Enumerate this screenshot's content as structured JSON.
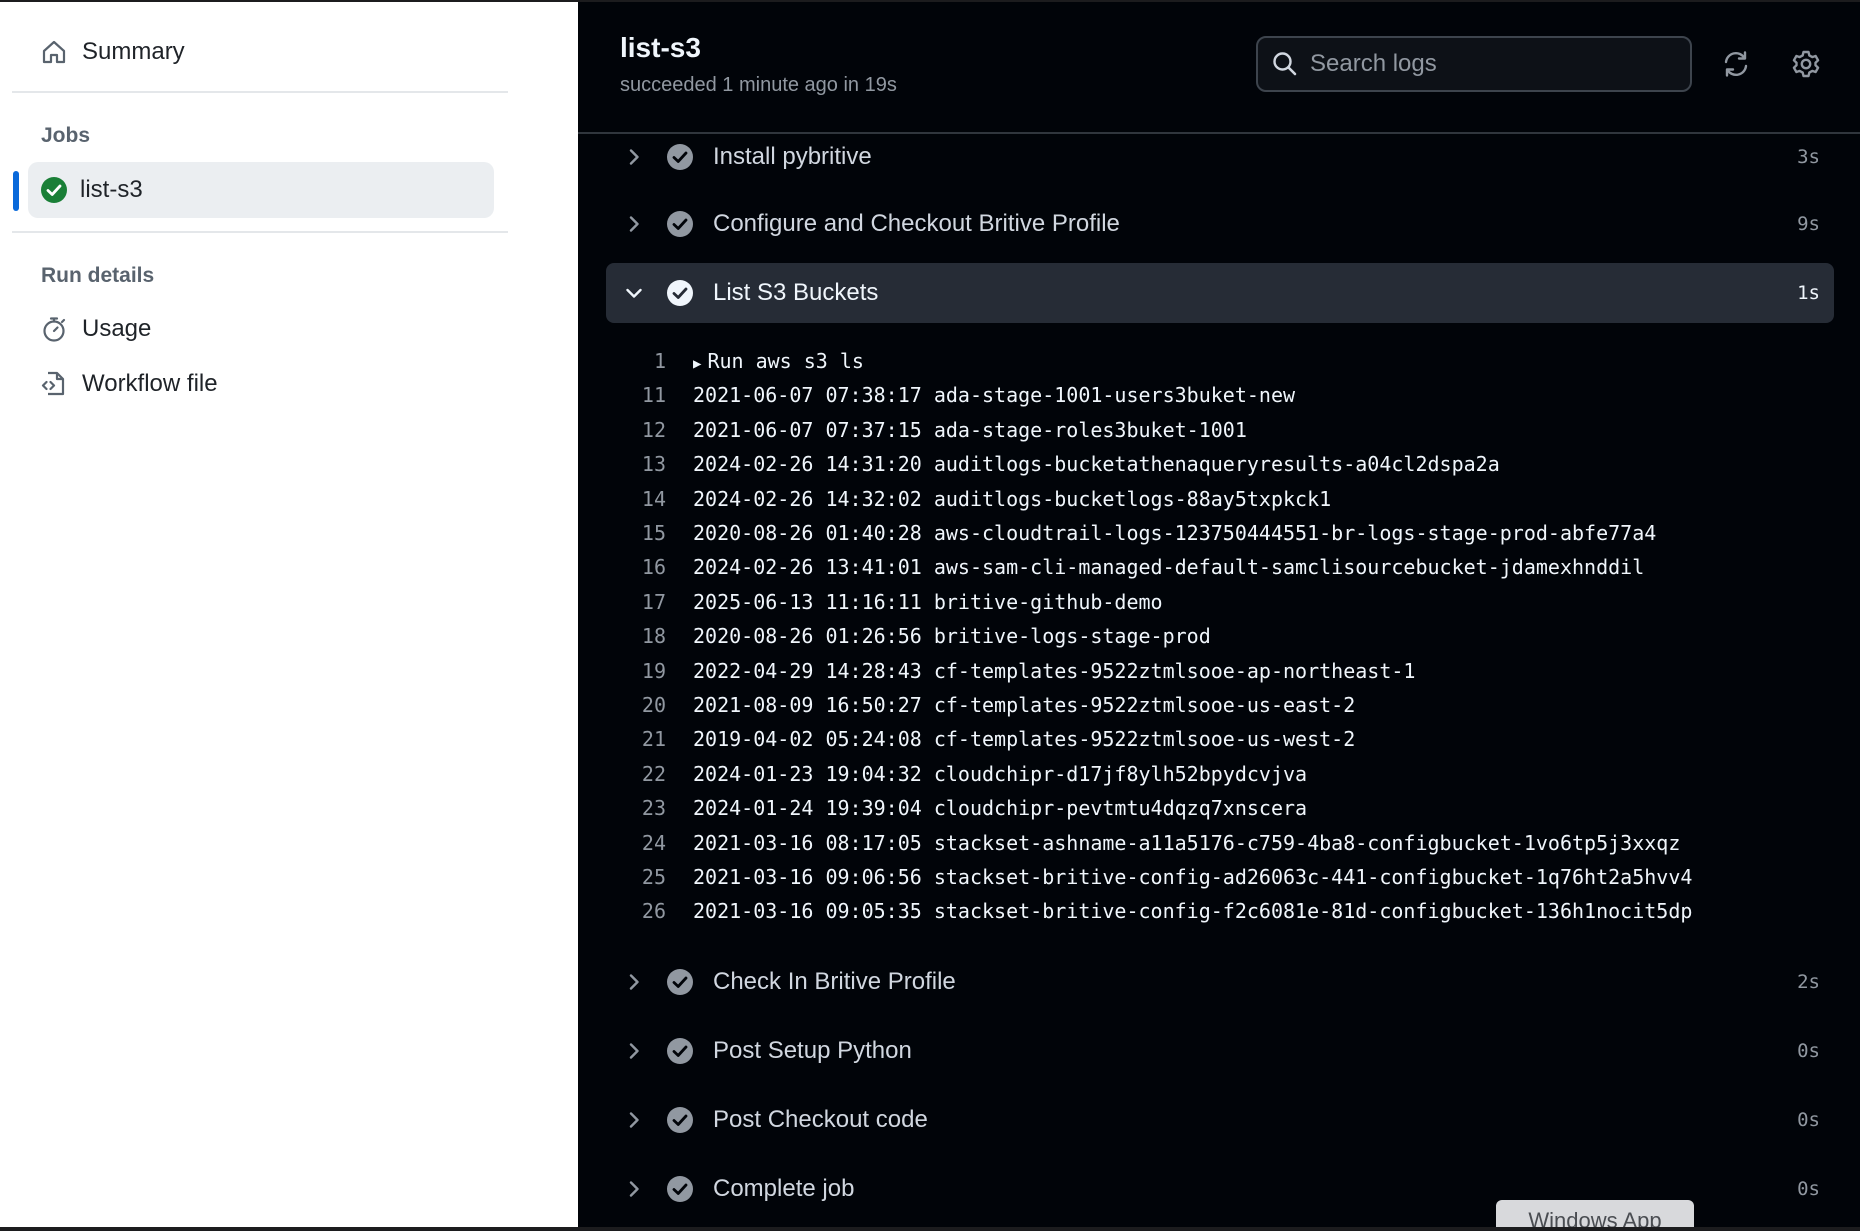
{
  "sidebar": {
    "summary_label": "Summary",
    "jobs_heading": "Jobs",
    "active_job": "list-s3",
    "run_details_heading": "Run details",
    "usage_label": "Usage",
    "workflow_file_label": "Workflow file",
    "accent_color": "#0969da",
    "success_color": "#1a7f37"
  },
  "header": {
    "title": "list-s3",
    "status": "succeeded 1 minute ago in 19s",
    "search_placeholder": "Search logs"
  },
  "steps_before": [
    {
      "name": "Install pybritive",
      "duration": "3s"
    },
    {
      "name": "Configure and Checkout Britive Profile",
      "duration": "9s"
    }
  ],
  "expanded_step": {
    "name": "List S3 Buckets",
    "duration": "1s"
  },
  "log": {
    "run_line": {
      "num": "1",
      "text": "Run aws s3 ls"
    },
    "lines": [
      {
        "num": "11",
        "text": "2021-06-07 07:38:17 ada-stage-1001-users3buket-new"
      },
      {
        "num": "12",
        "text": "2021-06-07 07:37:15 ada-stage-roles3buket-1001"
      },
      {
        "num": "13",
        "text": "2024-02-26 14:31:20 auditlogs-bucketathenaqueryresults-a04cl2dspa2a"
      },
      {
        "num": "14",
        "text": "2024-02-26 14:32:02 auditlogs-bucketlogs-88ay5txpkck1"
      },
      {
        "num": "15",
        "text": "2020-08-26 01:40:28 aws-cloudtrail-logs-123750444551-br-logs-stage-prod-abfe77a4"
      },
      {
        "num": "16",
        "text": "2024-02-26 13:41:01 aws-sam-cli-managed-default-samclisourcebucket-jdamexhnddil"
      },
      {
        "num": "17",
        "text": "2025-06-13 11:16:11 britive-github-demo"
      },
      {
        "num": "18",
        "text": "2020-08-26 01:26:56 britive-logs-stage-prod"
      },
      {
        "num": "19",
        "text": "2022-04-29 14:28:43 cf-templates-9522ztmlsooe-ap-northeast-1"
      },
      {
        "num": "20",
        "text": "2021-08-09 16:50:27 cf-templates-9522ztmlsooe-us-east-2"
      },
      {
        "num": "21",
        "text": "2019-04-02 05:24:08 cf-templates-9522ztmlsooe-us-west-2"
      },
      {
        "num": "22",
        "text": "2024-01-23 19:04:32 cloudchipr-d17jf8ylh52bpydcvjva"
      },
      {
        "num": "23",
        "text": "2024-01-24 19:39:04 cloudchipr-pevtmtu4dqzq7xnscera"
      },
      {
        "num": "24",
        "text": "2021-03-16 08:17:05 stackset-ashname-a11a5176-c759-4ba8-configbucket-1vo6tp5j3xxqz"
      },
      {
        "num": "25",
        "text": "2021-03-16 09:06:56 stackset-britive-config-ad26063c-441-configbucket-1q76ht2a5hvv4"
      },
      {
        "num": "26",
        "text": "2021-03-16 09:05:35 stackset-britive-config-f2c6081e-81d-configbucket-136h1nocit5dp"
      }
    ]
  },
  "steps_after": [
    {
      "name": "Check In Britive Profile",
      "duration": "2s"
    },
    {
      "name": "Post Setup Python",
      "duration": "0s"
    },
    {
      "name": "Post Checkout code",
      "duration": "0s"
    },
    {
      "name": "Complete job",
      "duration": "0s"
    }
  ],
  "toast_label": "Windows App"
}
